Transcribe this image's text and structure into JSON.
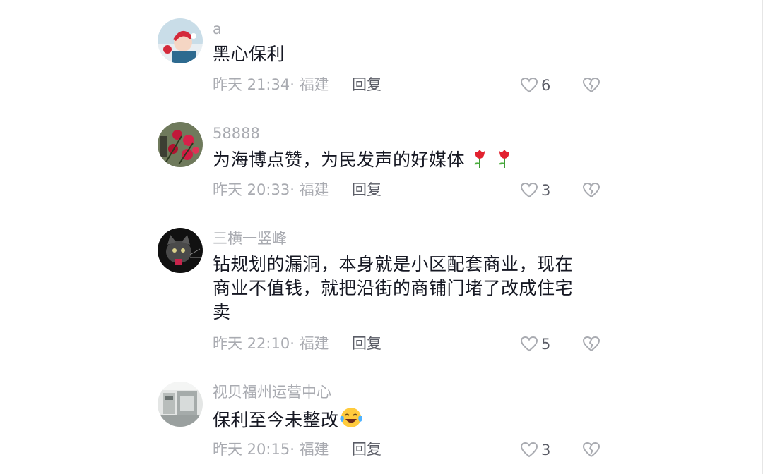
{
  "comments": [
    {
      "username": "a",
      "text": "黑心保利",
      "time": "昨天 21:34",
      "location": "福建",
      "reply_label": "回复",
      "likes": "6",
      "avatar_icon": "avatar-girl-santa-hat"
    },
    {
      "username": "58888",
      "text": "为海博点赞，为民发声的好媒体",
      "time": "昨天 20:33",
      "location": "福建",
      "reply_label": "回复",
      "likes": "3",
      "avatar_icon": "avatar-red-flowers"
    },
    {
      "username": "三横一竖峰",
      "text_lines": [
        "钻规划的漏洞，本身就是小区配套商业，现在",
        "商业不值钱，就把沿街的商铺门堵了改成住宅",
        "卖"
      ],
      "time": "昨天 22:10",
      "location": "福建",
      "reply_label": "回复",
      "likes": "5",
      "avatar_icon": "avatar-cat-dark"
    },
    {
      "username": "视贝福州运营中心",
      "text": "保利至今未整改",
      "time": "昨天 20:15",
      "location": "福建",
      "reply_label": "回复",
      "likes": "3",
      "avatar_icon": "avatar-showroom"
    }
  ],
  "emoji_icons": [
    "rose-emoji",
    "laugh-crying-emoji"
  ]
}
